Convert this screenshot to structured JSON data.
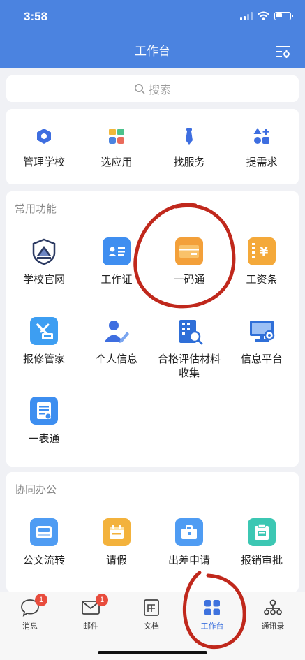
{
  "status_bar": {
    "time": "3:58"
  },
  "header": {
    "title": "工作台"
  },
  "search": {
    "placeholder": "搜索"
  },
  "quick_actions": [
    {
      "label": "管理学校",
      "icon": "hexagon-icon"
    },
    {
      "label": "选应用",
      "icon": "grid-icon"
    },
    {
      "label": "找服务",
      "icon": "tie-icon"
    },
    {
      "label": "提需求",
      "icon": "shapes-plus-icon"
    }
  ],
  "common": {
    "title": "常用功能",
    "items": [
      {
        "label": "学校官网",
        "icon": "school-emblem-icon"
      },
      {
        "label": "工作证",
        "icon": "id-card-icon"
      },
      {
        "label": "一码通",
        "icon": "card-icon"
      },
      {
        "label": "工资条",
        "icon": "salary-icon"
      },
      {
        "label": "报修管家",
        "icon": "repair-icon"
      },
      {
        "label": "个人信息",
        "icon": "person-edit-icon"
      },
      {
        "label": "合格评估材料收集",
        "icon": "building-search-icon"
      },
      {
        "label": "信息平台",
        "icon": "monitor-icon"
      },
      {
        "label": "一表通",
        "icon": "form-icon"
      }
    ]
  },
  "office": {
    "title": "协同办公",
    "items": [
      {
        "label": "公文流转",
        "icon": "inbox-icon"
      },
      {
        "label": "请假",
        "icon": "calendar-icon"
      },
      {
        "label": "出差申请",
        "icon": "briefcase-icon"
      },
      {
        "label": "报销审批",
        "icon": "clipboard-icon"
      }
    ]
  },
  "tabbar": [
    {
      "label": "消息",
      "badge": "1"
    },
    {
      "label": "邮件",
      "badge": "1"
    },
    {
      "label": "文档"
    },
    {
      "label": "工作台"
    },
    {
      "label": "通讯录"
    }
  ],
  "colors": {
    "header": "#4b83e0",
    "accent": "#3e72de",
    "badge": "#e84c3d",
    "annotation": "#c0281c"
  }
}
